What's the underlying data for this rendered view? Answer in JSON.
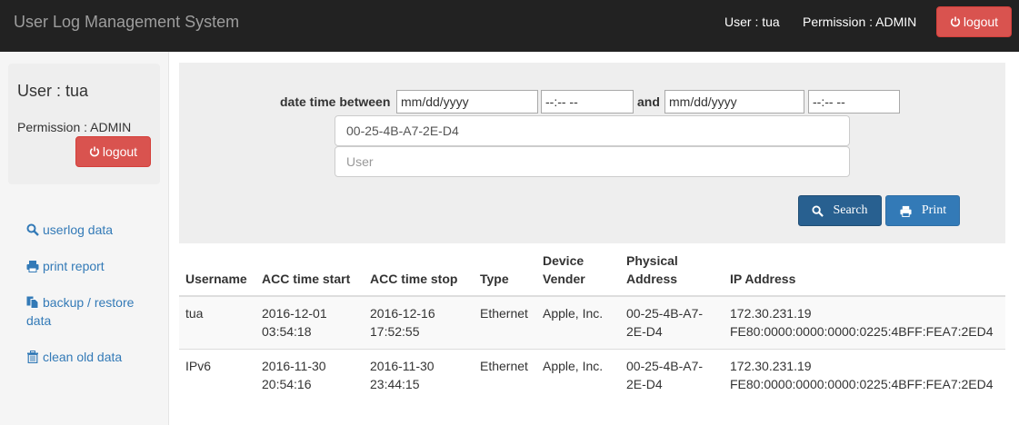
{
  "navbar": {
    "brand": "User Log Management System",
    "user": "User : tua",
    "permission": "Permission : ADMIN",
    "logout": "logout"
  },
  "sidebar": {
    "user": "User : tua",
    "permission": "Permission : ADMIN",
    "logout": "logout",
    "links": [
      {
        "icon": "search-icon",
        "label": "userlog data"
      },
      {
        "icon": "print-icon",
        "label": "print report"
      },
      {
        "icon": "files-icon",
        "label": "backup / restore data"
      },
      {
        "icon": "trash-icon",
        "label": "clean old data"
      }
    ]
  },
  "search": {
    "date_label": "date time between",
    "and_label": "and",
    "date_from_placeholder": "mm/dd/yyyy",
    "time_from_placeholder": "--:-- --",
    "date_to_placeholder": "mm/dd/yyyy",
    "time_to_placeholder": "--:-- --",
    "mac_value": "00-25-4B-A7-2E-D4",
    "user_placeholder": "User",
    "search_button": "Search",
    "print_button": "Print"
  },
  "table": {
    "headers": {
      "username": "Username",
      "acc_start": "ACC time start",
      "acc_stop": "ACC time stop",
      "type": "Type",
      "device_vender": "Device Vender",
      "physical_address": "Physical Address",
      "ip_address": "IP Address"
    },
    "rows": [
      {
        "username": "tua",
        "acc_start": "2016-12-01 03:54:18",
        "acc_stop": "2016-12-16 17:52:55",
        "type": "Ethernet",
        "vender": "Apple, Inc.",
        "physical": "00-25-4B-A7-2E-D4",
        "ipv4": "172.30.231.19",
        "ipv6": "FE80:0000:0000:0000:0225:4BFF:FEA7:2ED4"
      },
      {
        "username": "IPv6",
        "acc_start": "2016-11-30 20:54:16",
        "acc_stop": "2016-11-30 23:44:15",
        "type": "Ethernet",
        "vender": "Apple, Inc.",
        "physical": "00-25-4B-A7-2E-D4",
        "ipv4": "172.30.231.19",
        "ipv6": "FE80:0000:0000:0000:0225:4BFF:FEA7:2ED4"
      }
    ]
  },
  "colors": {
    "navbar": "#222222",
    "danger": "#d9534f",
    "primary": "#337ab7",
    "link": "#337ab7"
  }
}
